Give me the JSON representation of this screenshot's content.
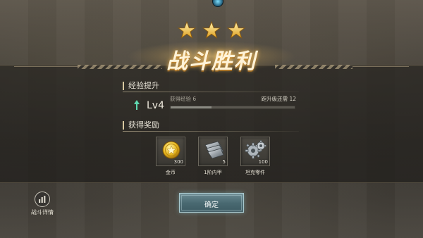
{
  "stars": 3,
  "title": "战斗胜利",
  "exp_section": {
    "header": "经验提升",
    "level": "Lv4",
    "exp_gained": "获得经验 6",
    "to_next_level": "距升级还需 12",
    "progress_fraction": 0.33
  },
  "rewards_section": {
    "header": "获得奖励",
    "items": [
      {
        "icon": "gold-coin-icon",
        "count": "300",
        "label": "金币"
      },
      {
        "icon": "armor-plate-icon",
        "count": "5",
        "label": "1阶内甲"
      },
      {
        "icon": "gear-parts-icon",
        "count": "100",
        "label": "坦克零件"
      }
    ]
  },
  "battle_stats_label": "战斗详情",
  "confirm_label": "确定",
  "colors": {
    "accent_gold": "#f3c94a",
    "confirm_button": "#4a6a72",
    "level_arrow": "#5fd8b0"
  }
}
